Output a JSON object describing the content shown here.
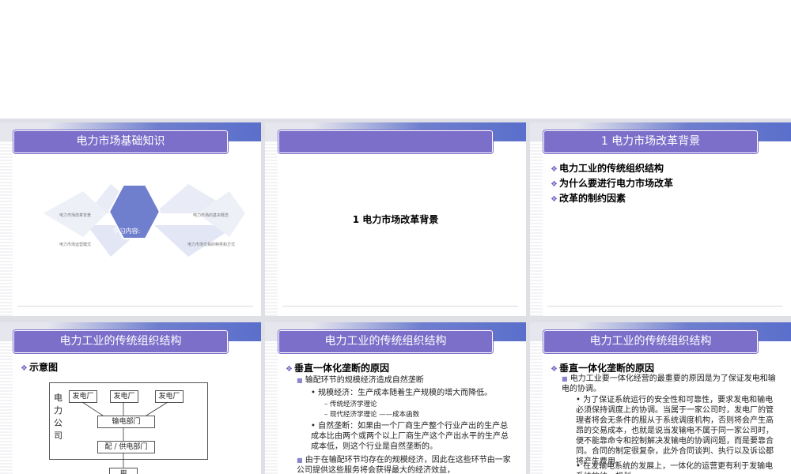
{
  "slides": [
    {
      "title": "电力市场基础知识",
      "center": "学习内容:",
      "labels": [
        "电力市场改革背景",
        "电力市场的基本概念",
        "电力市场运营模式",
        "电力市场交易的种类和方式"
      ]
    },
    {
      "title": "",
      "body": "1  电力市场改革背景"
    },
    {
      "title": "1  电力市场改革背景",
      "bullets": [
        "电力工业的传统组织结构",
        "为什么要进行电力市场改革",
        "改革的制约因素"
      ]
    },
    {
      "title": "电力工业的传统组织结构",
      "bullet": "示意图",
      "diagram": {
        "company": "电\n力\n公\n司",
        "gens": [
          "发电厂",
          "发电厂",
          "发电厂"
        ],
        "trans": "输电部门",
        "dist": "配 / 供电部门",
        "user": "用"
      }
    },
    {
      "title": "电力工业的传统组织结构",
      "heading": "垂直一体化垄断的原因",
      "l1": "输配环节的规模经济造成自然垄断",
      "l2a": "规模经济：生产成本随着生产规模的增大而降低。",
      "l3a": "– 传统经济学理论",
      "l3b": "– 现代经济学理论  ——成本函数",
      "l2b": "自然垄断：如果由一个厂商生产整个行业产出的生产总成本比由两个或两个以上厂商生产这个产出水平的生产总成本低，则这个行业是自然垄断的。",
      "l1b": "由于在输配环节均存在的规模经济，因此在这些环节由一家公司提供这些服务将会获得最大的经济效益，"
    },
    {
      "title": "电力工业的传统组织结构",
      "heading": "垂直一体化垄断的原因",
      "l1": "电力工业要一体化经营的最重要的原因是为了保证发电和输电的协调。",
      "l2a": "为了保证系统运行的安全性和可靠性，要求发电和输电必须保持调度上的协调。当属于一家公司时，发电厂的管理者将会无条件的服从于系统调度机构，否则将会产生高昂的交易成本，也就是说当发输电不属于同一家公司时，便不能靠命令和控制解决发输电的协调问题，而是要靠合同。合同的制定很复杂，此外合同谈判、执行以及诉讼都将产生费用。",
      "l2b": "在发输电系统的发展上，一体化的运营更有利于发输电系统的统一规划。"
    }
  ]
}
